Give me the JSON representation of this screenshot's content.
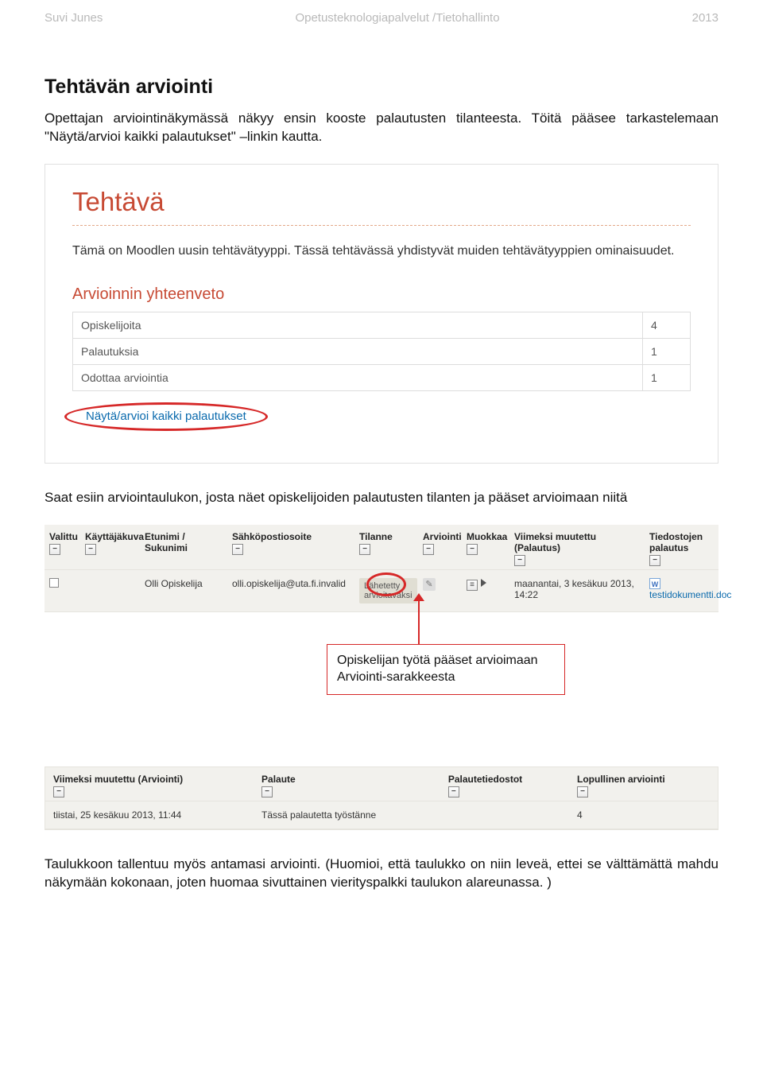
{
  "header": {
    "left": "Suvi Junes",
    "center": "Opetusteknologiapalvelut /Tietohallinto",
    "right": "2013"
  },
  "main": {
    "title": "Tehtävän arviointi",
    "p1": "Opettajan arviointinäkymässä näkyy ensin kooste palautusten tilanteesta. Töitä pääsee tarkastelemaan \"Näytä/arvioi kaikki palautukset\" –linkin kautta."
  },
  "shot1": {
    "title": "Tehtävä",
    "desc": "Tämä on Moodlen uusin tehtävätyyppi. Tässä tehtävässä yhdistyvät muiden tehtävätyyppien ominaisuudet.",
    "subtitle": "Arvioinnin yhteenveto",
    "rows": [
      {
        "label": "Opiskelijoita",
        "value": "4"
      },
      {
        "label": "Palautuksia",
        "value": "1"
      },
      {
        "label": "Odottaa arviointia",
        "value": "1"
      }
    ],
    "link": "Näytä/arvioi kaikki palautukset"
  },
  "mid_para": "Saat esiin arviointaulukon, josta näet opiskelijoiden palautusten tilanten ja pääset arvioimaan niitä",
  "shot2": {
    "headers": [
      "Valittu",
      "Käyttäjäkuva",
      "Etunimi / Sukunimi",
      "Sähköpostiosoite",
      "Tilanne",
      "Arviointi",
      "Muokkaa",
      "Viimeksi muutettu (Palautus)",
      "Tiedostojen palautus"
    ],
    "row": {
      "name": "Olli Opiskelija",
      "email": "olli.opiskelija@uta.fi.invalid",
      "status": "Lähetetty arvioitavaksi",
      "date": "maanantai, 3 kesäkuu 2013, 14:22",
      "file": "testidokumentti.doc"
    },
    "callout": "Opiskelijan työtä pääset arvioimaan Arviointi-sarakkeesta"
  },
  "shot3": {
    "headers": [
      "Viimeksi muutettu (Arviointi)",
      "Palaute",
      "Palautetiedostot",
      "Lopullinen arviointi"
    ],
    "row": {
      "date": "tiistai, 25 kesäkuu 2013, 11:44",
      "feedback": "Tässä palautetta työstänne",
      "final": "4"
    }
  },
  "last_para": "Taulukkoon tallentuu myös antamasi arviointi. (Huomioi, että taulukko on niin leveä, ettei se välttämättä mahdu näkymään kokonaan, joten huomaa sivuttainen vierityspalkki taulukon alareunassa. )"
}
